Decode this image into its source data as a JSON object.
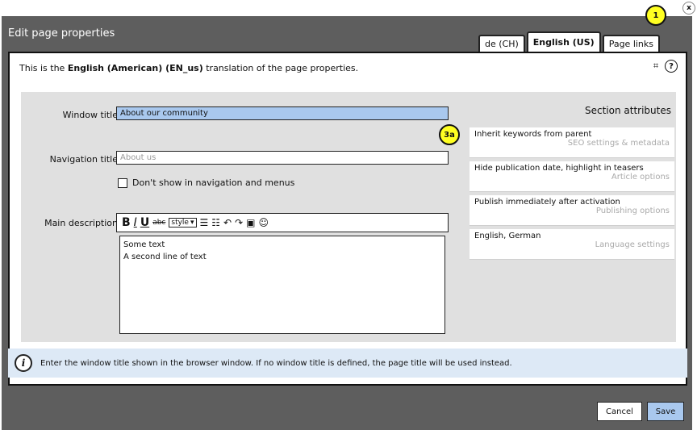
{
  "dialog": {
    "title": "Edit page properties",
    "tabs": [
      "de (CH)",
      "English (US)",
      "Page links"
    ],
    "active_tab": "English (US)",
    "close_icon": "close-icon"
  },
  "intro": {
    "prefix": "This is the ",
    "language": "English (American) (EN_us)",
    "suffix": " translation of the page properties."
  },
  "form": {
    "window_title_label": "Window title",
    "window_title_value": "About our community",
    "navigation_title_label": "Navigation title",
    "navigation_title_placeholder": "About us",
    "hide_nav_label": "Don't show in navigation and menus",
    "main_description_label": "Main description",
    "editor": {
      "style_label": "style",
      "lines": [
        "Some text",
        "A second line of text"
      ]
    }
  },
  "section_attributes": {
    "heading": "Section attributes",
    "items": [
      {
        "main": "Inherit keywords from parent",
        "sub": "SEO settings & metadata"
      },
      {
        "main": "Hide publication date, highlight in teasers",
        "sub": "Article options"
      },
      {
        "main": "Publish immediately after activation",
        "sub": "Publishing options"
      },
      {
        "main": "English, German",
        "sub": "Language settings"
      }
    ]
  },
  "info": {
    "text": "Enter the window title shown in the browser window. If no window title is defined, the page title will be used instead."
  },
  "buttons": {
    "cancel": "Cancel",
    "save": "Save"
  },
  "callouts": [
    "1",
    "3a"
  ],
  "colors": {
    "dialog_bg": "#5e5e5e",
    "focus_field": "#a9c8ee",
    "callout": "#ffff22",
    "info_bar": "#dde9f6"
  }
}
